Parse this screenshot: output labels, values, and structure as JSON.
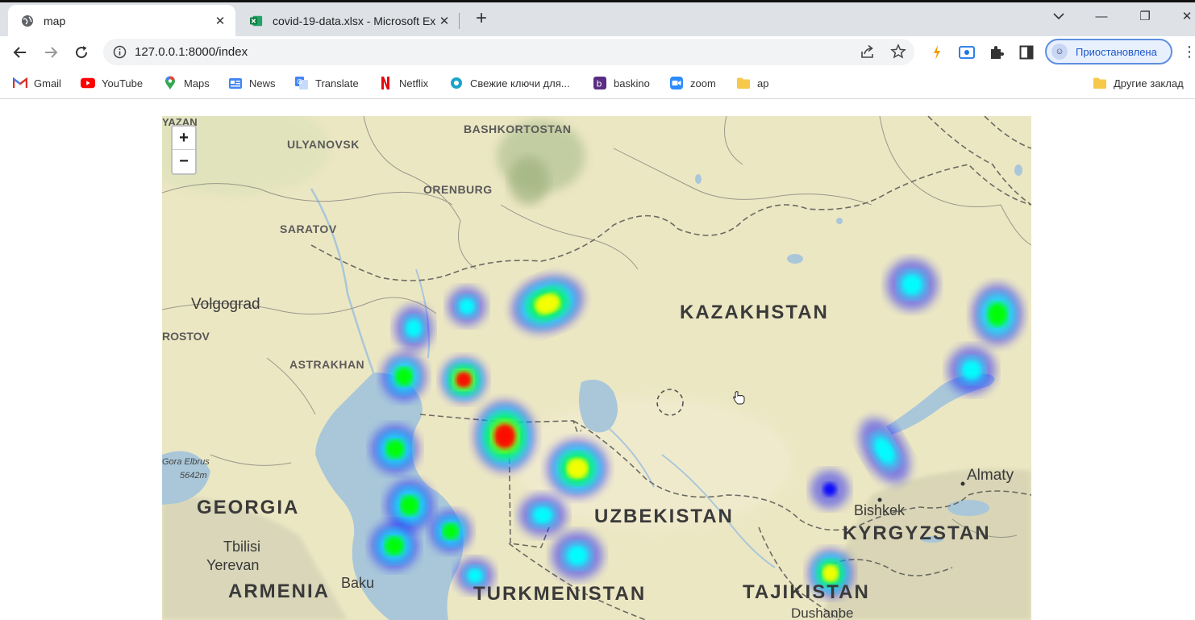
{
  "browser": {
    "tabs": [
      {
        "title": "map",
        "icon": "globe-icon",
        "active": true
      },
      {
        "title": "covid-19-data.xlsx - Microsoft Ex",
        "icon": "excel-icon",
        "active": false
      }
    ],
    "new_tab_label": "+",
    "window_controls": {
      "minimize": "—",
      "restore": "❐",
      "close": "✕"
    },
    "url": "127.0.0.1:8000/index",
    "profile_label": "Приостановлена",
    "bookmarks": [
      {
        "label": "Gmail",
        "icon": "gmail-icon",
        "color": "#d93025"
      },
      {
        "label": "YouTube",
        "icon": "youtube-icon",
        "color": "#ff0000"
      },
      {
        "label": "Maps",
        "icon": "maps-icon",
        "color": "#34a853"
      },
      {
        "label": "News",
        "icon": "news-icon",
        "color": "#4285f4"
      },
      {
        "label": "Translate",
        "icon": "translate-icon",
        "color": "#4285f4"
      },
      {
        "label": "Netflix",
        "icon": "netflix-icon",
        "color": "#e50914"
      },
      {
        "label": "Свежие ключи для...",
        "icon": "key-site-icon",
        "color": "#1aa3c9"
      },
      {
        "label": "baskino",
        "icon": "baskino-icon",
        "color": "#5a2d82"
      },
      {
        "label": "zoom",
        "icon": "zoom-icon",
        "color": "#2d8cff"
      },
      {
        "label": "ap",
        "icon": "folder-icon",
        "color": "#f6c94a"
      }
    ],
    "other_bookmarks": "Другие заклад"
  },
  "map": {
    "zoom_in": "+",
    "zoom_out": "−",
    "labels": {
      "yazan": "YAZAN",
      "bashkortostan": "BASHKORTOSTAN",
      "ulyanovsk": "ULYANOVSK",
      "orenburg": "ORENBURG",
      "saratov": "SARATOV",
      "volgograd": "Volgograd",
      "rostov": "ROSTOV",
      "astrakhan": "ASTRAKHAN",
      "kazakhstan": "KAZAKHSTAN",
      "elbrus": "Gora Elbrus",
      "elbrus_height": "5642m",
      "georgia": "GEORGIA",
      "tbilisi": "Tbilisi",
      "yerevan": "Yerevan",
      "armenia": "ARMENIA",
      "baku": "Baku",
      "uzbekistan": "UZBEKISTAN",
      "turkmenistan": "TURKMENISTAN",
      "almaty": "Almaty",
      "bishkek": "Bishkek",
      "kyrgyzstan": "KYRGYZSTAN",
      "tajikistan": "TAJIKISTAN",
      "dushanbe": "Dushanbe"
    },
    "heatmap_colors": [
      "#0000ff",
      "#00ffff",
      "#00ff00",
      "#ffff00",
      "#ff0000"
    ],
    "heat_points": [
      {
        "name": "north-aktobe",
        "intensity": 0.85
      },
      {
        "name": "aktobe-small",
        "intensity": 0.2
      },
      {
        "name": "uralsk",
        "intensity": 0.45
      },
      {
        "name": "atyrau-north",
        "intensity": 0.25
      },
      {
        "name": "atyrau",
        "intensity": 1.0
      },
      {
        "name": "aral-west",
        "intensity": 0.9
      },
      {
        "name": "aral",
        "intensity": 0.85
      },
      {
        "name": "caspian-west",
        "intensity": 0.5
      },
      {
        "name": "mangystau-1",
        "intensity": 0.45
      },
      {
        "name": "mangystau-2",
        "intensity": 0.4
      },
      {
        "name": "mangystau-3",
        "intensity": 0.4
      },
      {
        "name": "turkmen-1",
        "intensity": 0.35
      },
      {
        "name": "karakalpak",
        "intensity": 0.3
      },
      {
        "name": "turkmen-2",
        "intensity": 0.2
      },
      {
        "name": "pavlodar",
        "intensity": 0.3
      },
      {
        "name": "east-1",
        "intensity": 0.5
      },
      {
        "name": "east-2",
        "intensity": 0.35
      },
      {
        "name": "balkhash",
        "intensity": 0.15
      },
      {
        "name": "taraz",
        "intensity": 0.1
      },
      {
        "name": "tajik-north",
        "intensity": 0.75
      }
    ]
  }
}
